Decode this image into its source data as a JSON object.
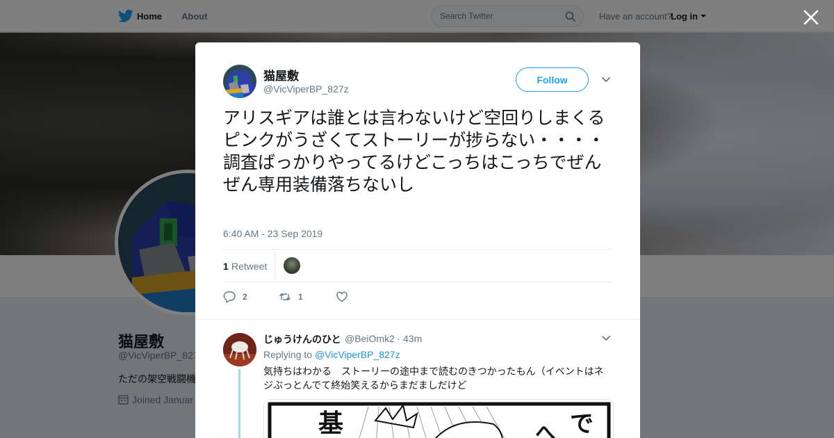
{
  "nav": {
    "home_label": "Home",
    "about_label": "About",
    "search_placeholder": "Search Twitter",
    "account_prompt": "Have an account?",
    "login_label": "Log in"
  },
  "profile": {
    "name": "猫屋敷",
    "handle": "@VicViperBP_827",
    "bio": "ただの架空戦闘機",
    "joined": "Joined Januar"
  },
  "tweet": {
    "author_name": "猫屋敷",
    "author_handle": "@VicViperBP_827z",
    "follow_label": "Follow",
    "text": "アリスギアは誰とは言わないけど空回りしまくるピンクがうざくてストーリーが捗らない・・・・\n調査ばっかりやってるけどこっちはこっちでぜんぜん専用装備落ちないし",
    "timestamp": "6:40 AM - 23 Sep 2019",
    "retweet_count": "1",
    "retweet_label": "Retweet",
    "reply_count": "2",
    "retweet_action_count": "1"
  },
  "reply": {
    "author_name": "じゅうけんのひと",
    "author_handle": "@BeiOmk2",
    "separator": "·",
    "time": "43m",
    "replying_prefix": "Replying to",
    "replying_to": "@VicViperBP_827z",
    "text": "気持ちはわかる　ストーリーの途中まで読むのきつかったもん（イベントはネジぶっとんでて終始笑えるからまだましだけど"
  },
  "colors": {
    "accent": "#1da1f2",
    "link": "#1b95e0",
    "muted": "#657786"
  }
}
